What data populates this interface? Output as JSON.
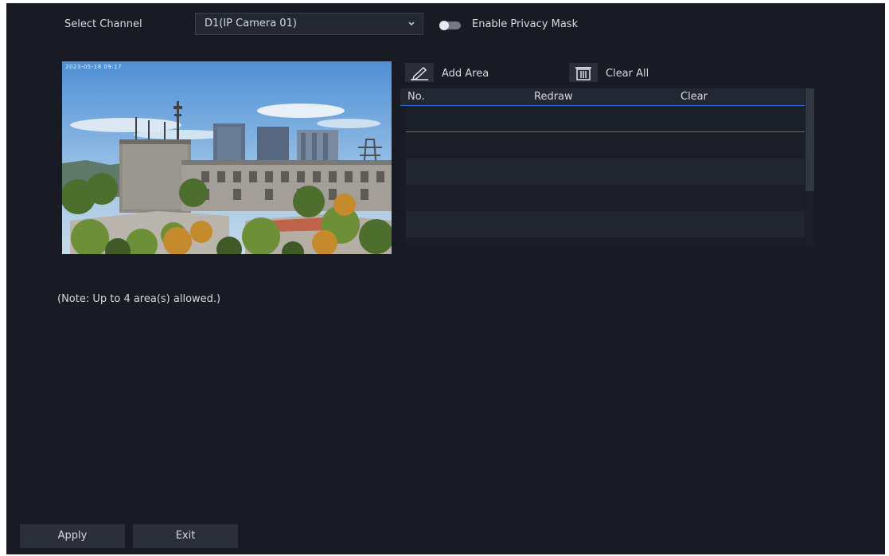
{
  "form": {
    "channel_label": "Select Channel",
    "channel_value": "D1(IP Camera 01)",
    "privacy_label": "Enable Privacy Mask",
    "privacy_enabled": false
  },
  "preview": {
    "osd_text": "2023-05-18 09:17"
  },
  "toolbar": {
    "add_area_label": "Add Area",
    "clear_all_label": "Clear All"
  },
  "table": {
    "columns": [
      "No.",
      "Redraw",
      "Clear"
    ],
    "rows": []
  },
  "note": "(Note: Up to 4 area(s) allowed.)",
  "buttons": {
    "apply_label": "Apply",
    "exit_label": "Exit"
  },
  "colors": {
    "background": "#181b23",
    "accent": "#2a73d6",
    "button": "#2b2f3a"
  }
}
